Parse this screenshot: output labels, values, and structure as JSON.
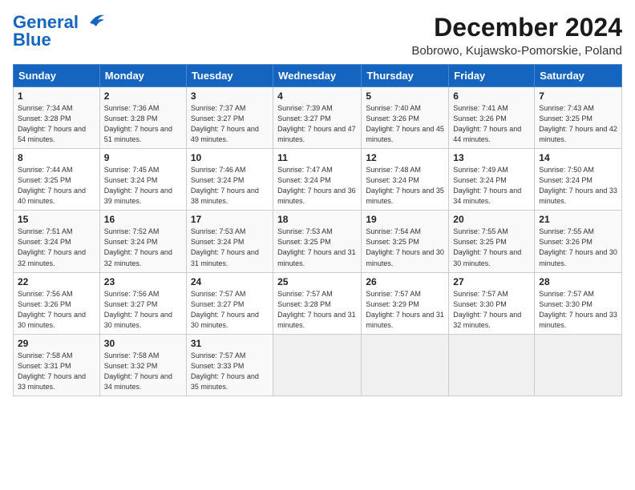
{
  "logo": {
    "line1": "General",
    "line2": "Blue"
  },
  "title": "December 2024",
  "subtitle": "Bobrowo, Kujawsko-Pomorskie, Poland",
  "headers": [
    "Sunday",
    "Monday",
    "Tuesday",
    "Wednesday",
    "Thursday",
    "Friday",
    "Saturday"
  ],
  "weeks": [
    [
      {
        "day": "1",
        "sunrise": "7:34 AM",
        "sunset": "3:28 PM",
        "daylight": "7 hours and 54 minutes."
      },
      {
        "day": "2",
        "sunrise": "7:36 AM",
        "sunset": "3:28 PM",
        "daylight": "7 hours and 51 minutes."
      },
      {
        "day": "3",
        "sunrise": "7:37 AM",
        "sunset": "3:27 PM",
        "daylight": "7 hours and 49 minutes."
      },
      {
        "day": "4",
        "sunrise": "7:39 AM",
        "sunset": "3:27 PM",
        "daylight": "7 hours and 47 minutes."
      },
      {
        "day": "5",
        "sunrise": "7:40 AM",
        "sunset": "3:26 PM",
        "daylight": "7 hours and 45 minutes."
      },
      {
        "day": "6",
        "sunrise": "7:41 AM",
        "sunset": "3:26 PM",
        "daylight": "7 hours and 44 minutes."
      },
      {
        "day": "7",
        "sunrise": "7:43 AM",
        "sunset": "3:25 PM",
        "daylight": "7 hours and 42 minutes."
      }
    ],
    [
      {
        "day": "8",
        "sunrise": "7:44 AM",
        "sunset": "3:25 PM",
        "daylight": "7 hours and 40 minutes."
      },
      {
        "day": "9",
        "sunrise": "7:45 AM",
        "sunset": "3:24 PM",
        "daylight": "7 hours and 39 minutes."
      },
      {
        "day": "10",
        "sunrise": "7:46 AM",
        "sunset": "3:24 PM",
        "daylight": "7 hours and 38 minutes."
      },
      {
        "day": "11",
        "sunrise": "7:47 AM",
        "sunset": "3:24 PM",
        "daylight": "7 hours and 36 minutes."
      },
      {
        "day": "12",
        "sunrise": "7:48 AM",
        "sunset": "3:24 PM",
        "daylight": "7 hours and 35 minutes."
      },
      {
        "day": "13",
        "sunrise": "7:49 AM",
        "sunset": "3:24 PM",
        "daylight": "7 hours and 34 minutes."
      },
      {
        "day": "14",
        "sunrise": "7:50 AM",
        "sunset": "3:24 PM",
        "daylight": "7 hours and 33 minutes."
      }
    ],
    [
      {
        "day": "15",
        "sunrise": "7:51 AM",
        "sunset": "3:24 PM",
        "daylight": "7 hours and 32 minutes."
      },
      {
        "day": "16",
        "sunrise": "7:52 AM",
        "sunset": "3:24 PM",
        "daylight": "7 hours and 32 minutes."
      },
      {
        "day": "17",
        "sunrise": "7:53 AM",
        "sunset": "3:24 PM",
        "daylight": "7 hours and 31 minutes."
      },
      {
        "day": "18",
        "sunrise": "7:53 AM",
        "sunset": "3:25 PM",
        "daylight": "7 hours and 31 minutes."
      },
      {
        "day": "19",
        "sunrise": "7:54 AM",
        "sunset": "3:25 PM",
        "daylight": "7 hours and 30 minutes."
      },
      {
        "day": "20",
        "sunrise": "7:55 AM",
        "sunset": "3:25 PM",
        "daylight": "7 hours and 30 minutes."
      },
      {
        "day": "21",
        "sunrise": "7:55 AM",
        "sunset": "3:26 PM",
        "daylight": "7 hours and 30 minutes."
      }
    ],
    [
      {
        "day": "22",
        "sunrise": "7:56 AM",
        "sunset": "3:26 PM",
        "daylight": "7 hours and 30 minutes."
      },
      {
        "day": "23",
        "sunrise": "7:56 AM",
        "sunset": "3:27 PM",
        "daylight": "7 hours and 30 minutes."
      },
      {
        "day": "24",
        "sunrise": "7:57 AM",
        "sunset": "3:27 PM",
        "daylight": "7 hours and 30 minutes."
      },
      {
        "day": "25",
        "sunrise": "7:57 AM",
        "sunset": "3:28 PM",
        "daylight": "7 hours and 31 minutes."
      },
      {
        "day": "26",
        "sunrise": "7:57 AM",
        "sunset": "3:29 PM",
        "daylight": "7 hours and 31 minutes."
      },
      {
        "day": "27",
        "sunrise": "7:57 AM",
        "sunset": "3:30 PM",
        "daylight": "7 hours and 32 minutes."
      },
      {
        "day": "28",
        "sunrise": "7:57 AM",
        "sunset": "3:30 PM",
        "daylight": "7 hours and 33 minutes."
      }
    ],
    [
      {
        "day": "29",
        "sunrise": "7:58 AM",
        "sunset": "3:31 PM",
        "daylight": "7 hours and 33 minutes."
      },
      {
        "day": "30",
        "sunrise": "7:58 AM",
        "sunset": "3:32 PM",
        "daylight": "7 hours and 34 minutes."
      },
      {
        "day": "31",
        "sunrise": "7:57 AM",
        "sunset": "3:33 PM",
        "daylight": "7 hours and 35 minutes."
      },
      null,
      null,
      null,
      null
    ]
  ]
}
